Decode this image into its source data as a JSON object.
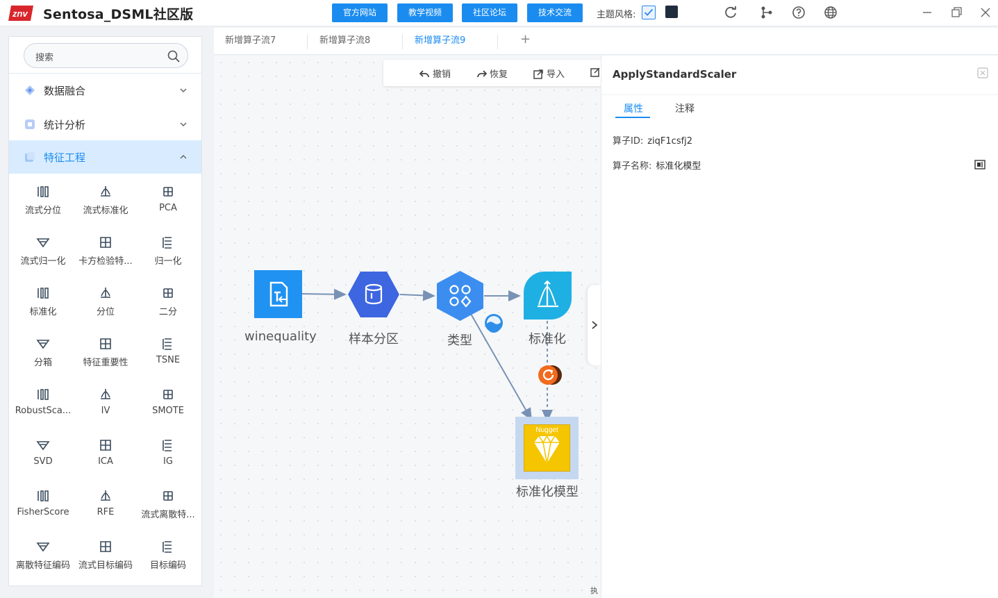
{
  "app": {
    "logo_text": "znv",
    "title": "Sentosa_DSML社区版"
  },
  "topbar": {
    "buttons": [
      "官方网站",
      "教学视频",
      "社区论坛",
      "技术交流"
    ],
    "theme_label": "主题风格:",
    "icons": [
      "refresh-icon",
      "branch-icon",
      "help-icon",
      "globe-icon"
    ],
    "window_controls": [
      "minimize-icon",
      "restore-icon",
      "close-icon"
    ]
  },
  "sidebar": {
    "search_placeholder": "搜索",
    "categories": [
      {
        "label": "数据融合",
        "expanded": false
      },
      {
        "label": "统计分析",
        "expanded": false
      },
      {
        "label": "特征工程",
        "expanded": true
      }
    ],
    "operators": [
      "流式分位",
      "流式标准化",
      "PCA",
      "流式归一化",
      "卡方检验特...",
      "归一化",
      "标准化",
      "分位",
      "二分",
      "分箱",
      "特征重要性",
      "TSNE",
      "RobustSca...",
      "IV",
      "SMOTE",
      "SVD",
      "ICA",
      "IG",
      "FisherScore",
      "RFE",
      "流式离散特...",
      "离散特征编码",
      "流式目标编码",
      "目标编码"
    ]
  },
  "tabs": [
    {
      "label": "新增算子流7",
      "active": false
    },
    {
      "label": "新增算子流8",
      "active": false
    },
    {
      "label": "新增算子流9",
      "active": true
    }
  ],
  "tab_add": "+",
  "toolbar": {
    "undo": "撤销",
    "redo": "恢复",
    "import": "导入"
  },
  "nodes": {
    "source": "winequality",
    "partition": "样本分区",
    "type": "类型",
    "standardize": "标准化",
    "model": "标准化模型",
    "nugget_badge": "Nugget"
  },
  "properties": {
    "title": "ApplyStandardScaler",
    "tabs": [
      "属性",
      "注释"
    ],
    "id_label": "算子ID:",
    "id_value": "ziqF1csfj2",
    "name_label": "算子名称:",
    "name_value": "标准化模型"
  },
  "footer": {
    "exec_label": "执"
  }
}
